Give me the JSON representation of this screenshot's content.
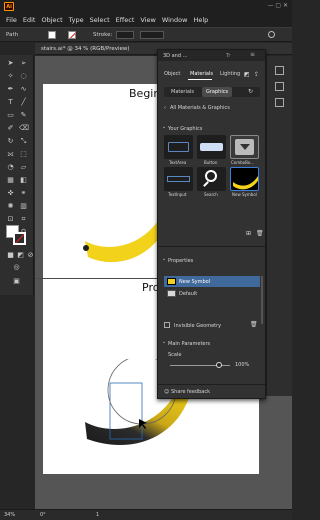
{
  "app": {
    "logo": "Ai"
  },
  "menu": [
    "File",
    "Edit",
    "Object",
    "Type",
    "Select",
    "Effect",
    "View",
    "Window",
    "Help"
  ],
  "control_bar": {
    "selection_label": "Path",
    "stroke_label": "Stroke:"
  },
  "document": {
    "tab_title": "stairs.ai* @ 34 % (RGB/Preview)"
  },
  "artboards": {
    "top_heading": "Begin",
    "bottom_heading": "Pro"
  },
  "panel": {
    "tabs": [
      "3D and ...",
      "Tr"
    ],
    "subtabs": [
      "Object",
      "Materials",
      "Lighting"
    ],
    "mode_tabs": [
      "Materials",
      "Graphics"
    ],
    "all_materials_label": "All Materials & Graphics",
    "your_graphics_label": "Your Graphics",
    "graphics": [
      "TextArea",
      "Button",
      "ComboBo...",
      "TextInput",
      "Search",
      "New Symbol"
    ],
    "properties_label": "Properties",
    "property_items": [
      "New Symbol",
      "Default"
    ],
    "invisible_geometry_label": "Invisible Geometry",
    "main_parameters_label": "Main Parameters",
    "scale_label": "Scale",
    "scale_value": "100%",
    "scale_fraction": 0.82,
    "share_feedback": "Share feedback"
  },
  "status": {
    "zoom": "34%",
    "angle": "0°",
    "page": "1"
  },
  "colors": {
    "accent": "#2a6db5",
    "banana": "#f3d21b",
    "banana_dark": "#1f1f1f"
  }
}
